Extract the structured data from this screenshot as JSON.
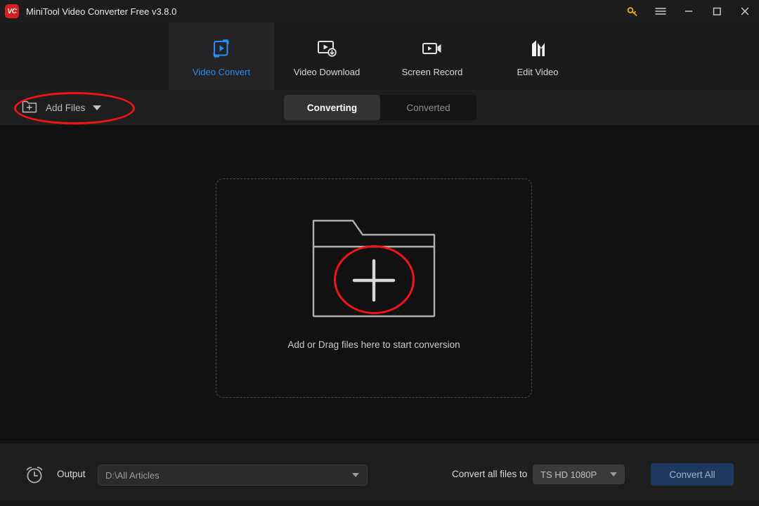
{
  "titlebar": {
    "logo_text": "VC",
    "title": "MiniTool Video Converter Free v3.8.0",
    "controls": [
      {
        "name": "key-icon",
        "label": ""
      },
      {
        "name": "menu-icon",
        "label": ""
      },
      {
        "name": "minimize-icon",
        "label": ""
      },
      {
        "name": "maximize-icon",
        "label": ""
      },
      {
        "name": "close-icon",
        "label": ""
      }
    ],
    "accent_key_color": "#e8a317"
  },
  "nav": {
    "active_color": "#2a8cf0",
    "tabs": [
      {
        "label": "Video Convert",
        "icon": "video-convert-icon",
        "active": true
      },
      {
        "label": "Video Download",
        "icon": "video-download-icon",
        "active": false
      },
      {
        "label": "Screen Record",
        "icon": "screen-record-icon",
        "active": false
      },
      {
        "label": "Edit Video",
        "icon": "edit-video-icon",
        "active": false
      }
    ]
  },
  "toolbar": {
    "add_files_label": "Add Files",
    "add_files_icon": "folder-plus-icon",
    "tabs": [
      {
        "label": "Converting",
        "active": true
      },
      {
        "label": "Converted",
        "active": false
      }
    ]
  },
  "main": {
    "drop_text": "Add or Drag files here to start conversion",
    "folder_icon": "folder-plus-large-icon"
  },
  "bottom": {
    "clock_icon": "alarm-clock-icon",
    "output_label": "Output",
    "output_path": "D:\\All Articles",
    "convert_to_label": "Convert all files to",
    "format_value": "TS HD 1080P",
    "convert_all_label": "Convert All",
    "convert_all_color": "#1e395e"
  },
  "annotations": {
    "highlight_color": "#f21414",
    "shapes": [
      {
        "name": "add-files-highlight",
        "type": "ellipse"
      },
      {
        "name": "folder-plus-highlight",
        "type": "ellipse"
      }
    ]
  }
}
